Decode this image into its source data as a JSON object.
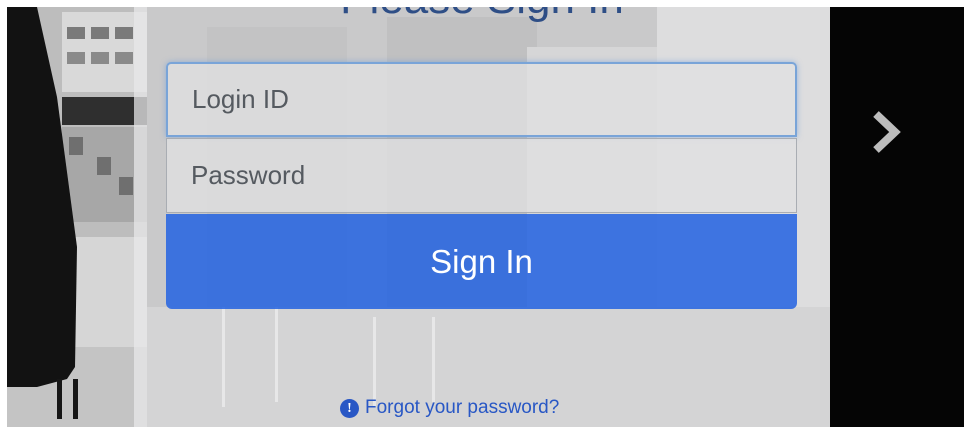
{
  "signin_form": {
    "title": "Please Sign In",
    "login_placeholder": "Login ID",
    "password_placeholder": "Password",
    "signin_label": "Sign In",
    "forgot_link": "Forgot your password?"
  },
  "carousel": {
    "next_icon": "chevron-right-icon"
  },
  "colors": {
    "title": "#2e4e86",
    "signin_button": "#2463e1",
    "link": "#2857c5",
    "focus_border": "#79a4d8",
    "right_strip": "#050505"
  },
  "icons": {
    "forgot_icon": "info-circle-icon"
  }
}
